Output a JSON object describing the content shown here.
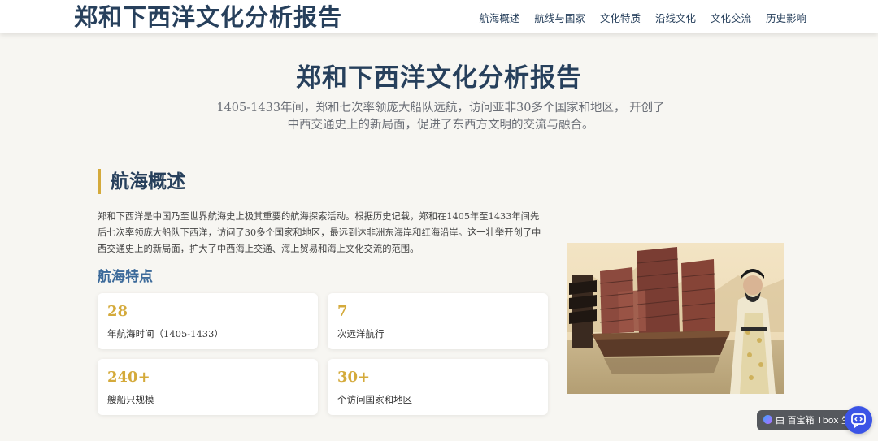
{
  "header": {
    "brand": "郑和下西洋文化分析报告",
    "nav": [
      "航海概述",
      "航线与国家",
      "文化特质",
      "沿线文化",
      "文化交流",
      "历史影响"
    ]
  },
  "hero": {
    "title": "郑和下西洋文化分析报告",
    "subtitle": "1405-1433年间，郑和七次率领庞大船队远航，访问亚非30多个国家和地区， 开创了中西交通史上的新局面，促进了东西方文明的交流与融合。"
  },
  "section": {
    "title": "航海概述",
    "intro": "郑和下西洋是中国乃至世界航海史上极其重要的航海探索活动。根据历史记载，郑和在1405年至1433年间先后七次率领庞大船队下西洋，访问了30多个国家和地区，最远到达非洲东海岸和红海沿岸。这一壮举开创了中西交通史上的新局面，扩大了中西海上交通、海上贸易和海上文化交流的范围。",
    "features_title": "航海特点",
    "stats": [
      {
        "value": "28",
        "label": "年航海时间（1405-1433）"
      },
      {
        "value": "7",
        "label": "次远洋航行"
      },
      {
        "value": "240+",
        "label": "艘船只规模"
      },
      {
        "value": "30+",
        "label": "个访问国家和地区"
      }
    ]
  },
  "widget": {
    "label": "由 百宝箱 Tbox 生"
  },
  "icons": {
    "painting": "treasure-fleet-painting",
    "help": "chat-help-icon"
  },
  "colors": {
    "brand": "#27405c",
    "accent_gold": "#d4aa3b",
    "subhead_blue": "#3c6a9a",
    "background": "#f7f6f2"
  }
}
